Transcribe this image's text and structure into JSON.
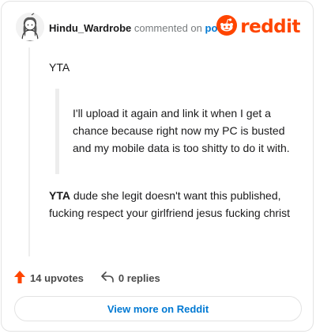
{
  "comment": {
    "username": "Hindu_Wardrobe",
    "action_text": "commented on",
    "post_link": "post",
    "brand": "reddit",
    "text_1": "YTA",
    "quote": "I'll upload it again and link it when I get a chance because right now my PC is busted and my mobile data is too shitty to do it with.",
    "text_2_bold": "YTA",
    "text_2_rest": " dude she legit doesn't want this published, fucking respect your girlfriend jesus fucking christ"
  },
  "actions": {
    "upvotes": "14 upvotes",
    "replies": "0 replies"
  },
  "footer": {
    "view_more": "View more on Reddit"
  },
  "colors": {
    "brand": "#ff4500",
    "link": "#0079d3",
    "upvote": "#ff4500"
  },
  "icons": [
    "user-avatar",
    "reddit-logo-icon",
    "upvote-arrow-icon",
    "reply-arrow-icon"
  ]
}
